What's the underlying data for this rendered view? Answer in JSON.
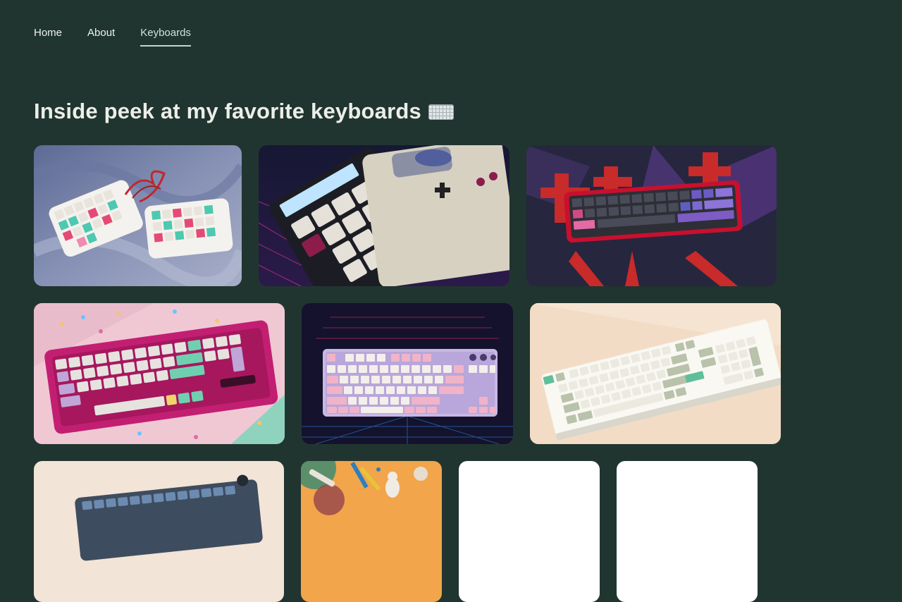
{
  "nav": {
    "items": [
      {
        "label": "Home",
        "active": false
      },
      {
        "label": "About",
        "active": false
      },
      {
        "label": "Keyboards",
        "active": true
      }
    ]
  },
  "page": {
    "title": "Inside peek at my favorite keyboards",
    "title_icon": "keyboard-emoji"
  },
  "gallery": {
    "items": [
      {
        "name": "split-ergo-keyboard-photo",
        "description_hidden": true
      },
      {
        "name": "numpad-and-gameboy-photo"
      },
      {
        "name": "red-keyboard-art-photo"
      },
      {
        "name": "pink-keyboard-on-mint-photo"
      },
      {
        "name": "lavender-tkl-keyboard-photo"
      },
      {
        "name": "white-green-fullsize-keyboard-photo"
      },
      {
        "name": "blue-keyboard-photo"
      },
      {
        "name": "art-supplies-photo"
      },
      {
        "name": "placeholder-photo-1"
      },
      {
        "name": "placeholder-photo-2"
      }
    ]
  },
  "colors": {
    "background": "#213530",
    "nav_active_underline": "#bcd8ce",
    "text": "#eceee9"
  }
}
